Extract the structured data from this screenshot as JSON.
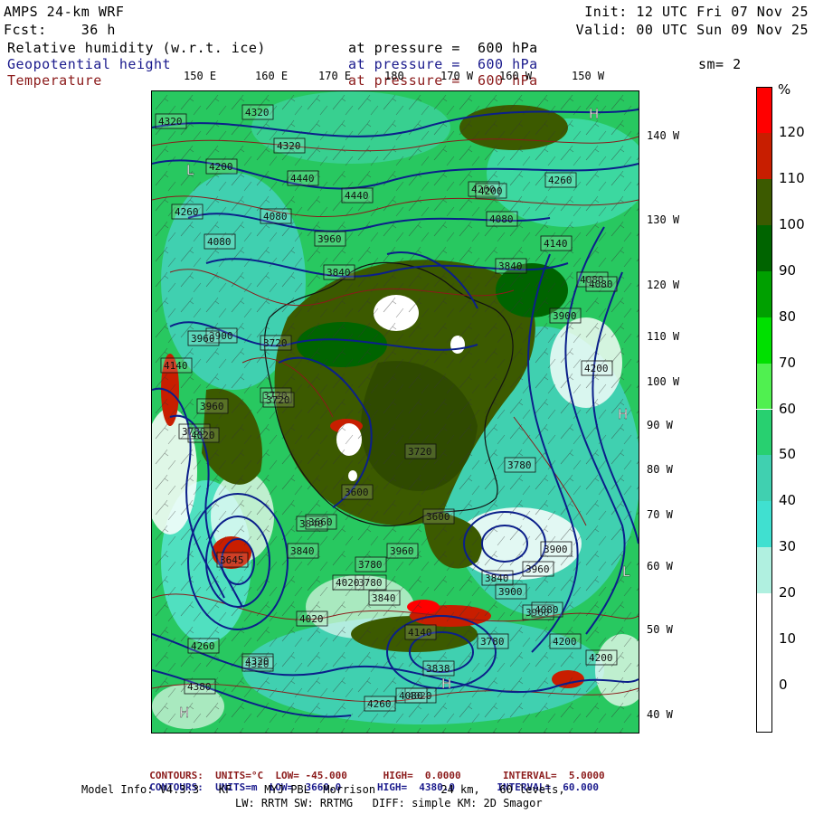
{
  "header": {
    "model": "AMPS 24-km WRF",
    "fcst_label": "Fcst:",
    "fcst_value": "36 h",
    "init": "Init: 12 UTC Fri 07 Nov 25",
    "valid": "Valid: 00 UTC Sun 09 Nov 25",
    "fields": [
      {
        "name": "Relative humidity (w.r.t. ice)",
        "level": "at pressure =  600 hPa",
        "color": "#000000"
      },
      {
        "name": "Geopotential height",
        "level": "at pressure =  600 hPa",
        "color": "#1a1a8c"
      },
      {
        "name": "Temperature",
        "level": "at pressure =  600 hPa",
        "color": "#8b1a1a"
      }
    ],
    "smoothing": "sm= 2"
  },
  "lon_labels": [
    "150 E",
    "160 E",
    "170 E",
    "180",
    "170 W",
    "160 W",
    "150 W"
  ],
  "lat_labels": [
    "140 W",
    "130 W",
    "120 W",
    "110 W",
    "100 W",
    "90 W",
    "80 W",
    "70 W",
    "60 W",
    "50 W",
    "40 W"
  ],
  "colorbar": {
    "unit": "%",
    "ticks": [
      "120",
      "110",
      "100",
      "90",
      "80",
      "70",
      "60",
      "50",
      "40",
      "30",
      "20",
      "10",
      "0"
    ],
    "colors": [
      "#ff0000",
      "#c81e00",
      "#3c5a00",
      "#006400",
      "#00a000",
      "#00e000",
      "#50f050",
      "#28d070",
      "#40d0b0",
      "#40e0d0",
      "#b0f0e0",
      "#ffffff",
      "#ffffff",
      "#ffffff"
    ]
  },
  "height_labels": [
    "4320",
    "4320",
    "4320",
    "4200",
    "4440",
    "4440",
    "4200",
    "4260",
    "4260",
    "4080",
    "4080",
    "4200",
    "4080",
    "3960",
    "4140",
    "3840",
    "4080",
    "3840",
    "3900",
    "4080",
    "3900",
    "3960",
    "3720",
    "4140",
    "4200",
    "3960",
    "3720",
    "3600",
    "3780",
    "4020",
    "3720",
    "3720",
    "3840",
    "3600",
    "3780",
    "3660",
    "3840",
    "3960",
    "3780",
    "3900",
    "3960",
    "3840",
    "3645",
    "3780",
    "4020",
    "3840",
    "3960",
    "4080",
    "4200",
    "4200",
    "4140",
    "4020",
    "4260",
    "4320",
    "3838",
    "4320",
    "4380",
    "4260",
    "4020",
    "4080",
    "3780",
    "3900"
  ],
  "hl_marks": [
    "L",
    "H",
    "H",
    "H",
    "L",
    "H"
  ],
  "footer": {
    "temp_contours": {
      "label": "CONTOURS:",
      "units": "UNITS=°C",
      "low": "LOW= -45.000",
      "high": "HIGH=  0.0000",
      "interval": "INTERVAL=  5.0000",
      "color": "#8b1a1a"
    },
    "hgt_contours": {
      "label": "CONTOURS:",
      "units": "UNITS=m",
      "low": "LOW=  3660.0",
      "high": "HIGH=  4380.0",
      "interval": "INTERVAL=  60.000",
      "color": "#1a1a8c"
    },
    "model_info_1": "Model Info: V4.3.3   KF     MYJ PBL  Morrison          24 km,   60 levels,",
    "model_info_2": "LW: RRTM SW: RRTMG   DIFF: simple KM: 2D Smagor"
  }
}
